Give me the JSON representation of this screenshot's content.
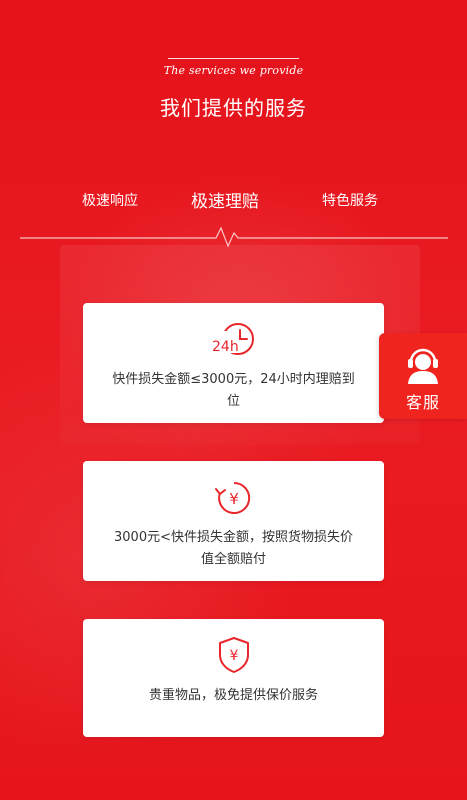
{
  "header": {
    "subtitle": "The services we provide",
    "title": "我们提供的服务"
  },
  "tabs": [
    {
      "label": "极速响应",
      "active": false
    },
    {
      "label": "极速理赔",
      "active": true
    },
    {
      "label": "特色服务",
      "active": false
    }
  ],
  "cards": [
    {
      "icon": "24h-clock-icon",
      "icon_text": "24h",
      "text": "快件损失金额≤3000元，24小时内理赔到位"
    },
    {
      "icon": "yuan-refresh-icon",
      "icon_text": "¥",
      "text": "3000元<快件损失金额，按照货物损失价值全额赔付"
    },
    {
      "icon": "yuan-shield-icon",
      "icon_text": "¥",
      "text": "贵重物品，极免提供保价服务"
    }
  ],
  "customer_service": {
    "label": "客服",
    "icon": "headset-agent-icon"
  },
  "colors": {
    "brand_red": "#e8151d",
    "icon_red": "#e8262b",
    "button_red": "#f0241e"
  }
}
